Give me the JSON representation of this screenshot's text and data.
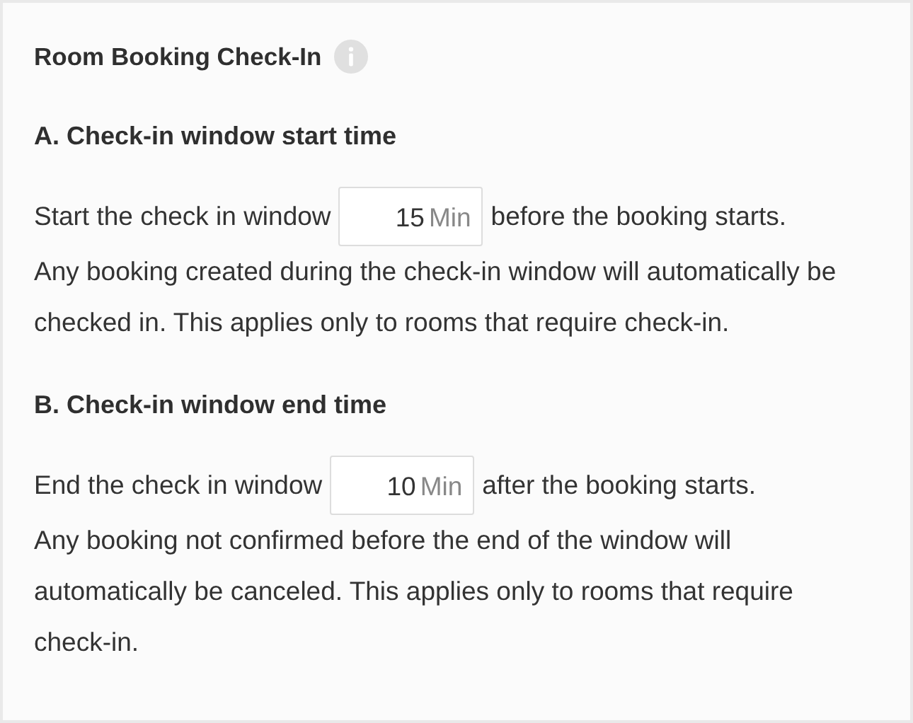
{
  "title": "Room Booking Check-In",
  "sections": [
    {
      "heading": "A. Check-in window start time",
      "before": "Start the check in window",
      "value": "15",
      "unit": "Min",
      "after": "before the booking starts.",
      "note": "Any booking created during the check-in window will automatically be checked in. This applies only to rooms that require check-in."
    },
    {
      "heading": "B. Check-in window end time",
      "before": "End the check in window",
      "value": "10",
      "unit": "Min",
      "after": "after the booking starts.",
      "note": "Any booking not confirmed before the end of the window will automatically be canceled. This applies only to rooms that require check-in."
    }
  ]
}
